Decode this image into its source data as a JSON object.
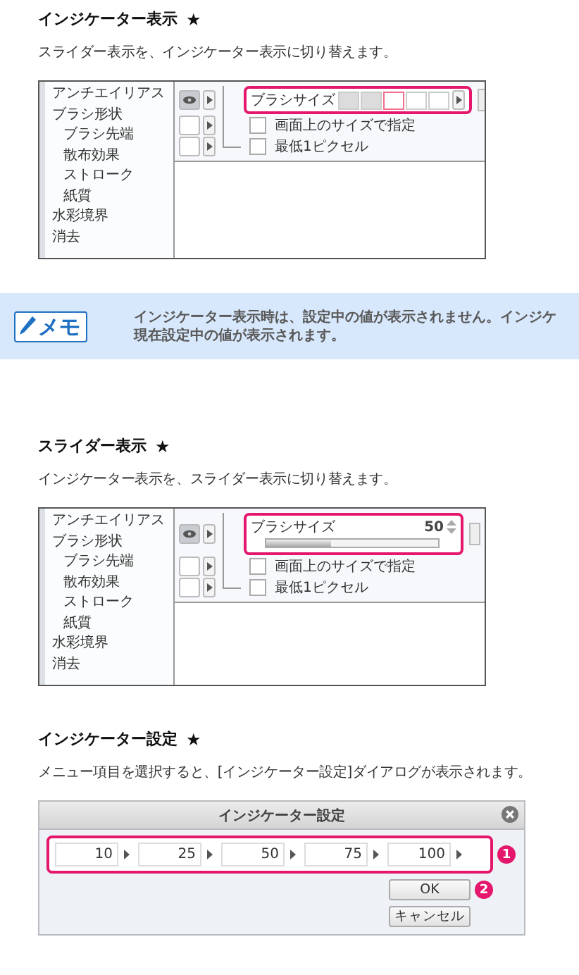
{
  "blocks": [
    {
      "kind": "section",
      "heading": "インジケーター表示",
      "mark": "★",
      "description": "スライダー表示を、インジケーター表示に切り替えます。",
      "panel": {
        "kind": "indicator",
        "categories": [
          {
            "label": "アンチエイリアス"
          },
          {
            "label": "ブラシ形状",
            "children": [
              {
                "label": "ブラシ先端"
              },
              {
                "label": "散布効果"
              },
              {
                "label": "ストローク"
              },
              {
                "label": "紙質"
              }
            ]
          },
          {
            "label": "水彩境界"
          },
          {
            "label": "消去"
          }
        ],
        "size_row": {
          "label": "ブラシサイズ",
          "eye": true,
          "cells": [
            {
              "filled": true,
              "selected": false
            },
            {
              "filled": true,
              "selected": false
            },
            {
              "filled": false,
              "selected": true
            },
            {
              "filled": false,
              "selected": false
            },
            {
              "filled": false,
              "selected": false
            }
          ]
        },
        "options": [
          {
            "label": "画面上のサイズで指定",
            "checked": false,
            "eye": false
          },
          {
            "label": "最低1ピクセル",
            "checked": false,
            "eye": false
          }
        ]
      }
    },
    {
      "kind": "memo",
      "label": "メモ",
      "lines": [
        "インジケーター表示時は、設定中の値が表示されません。インジケ",
        "現在設定中の値が表示されます。"
      ]
    },
    {
      "kind": "section",
      "heading": "スライダー表示",
      "mark": "★",
      "description": "インジケーター表示を、スライダー表示に切り替えます。",
      "panel": {
        "kind": "slider",
        "categories": [
          {
            "label": "アンチエイリアス"
          },
          {
            "label": "ブラシ形状",
            "children": [
              {
                "label": "ブラシ先端"
              },
              {
                "label": "散布効果"
              },
              {
                "label": "ストローク"
              },
              {
                "label": "紙質"
              }
            ]
          },
          {
            "label": "水彩境界"
          },
          {
            "label": "消去"
          }
        ],
        "size_row": {
          "label": "ブラシサイズ",
          "eye": true,
          "value": "50",
          "level": 0.38
        },
        "options": [
          {
            "label": "画面上のサイズで指定",
            "checked": false,
            "eye": false
          },
          {
            "label": "最低1ピクセル",
            "checked": false,
            "eye": false
          }
        ]
      }
    },
    {
      "kind": "section",
      "heading": "インジケーター設定",
      "mark": "★",
      "description": "メニュー項目を選択すると、[インジケーター設定]ダイアログが表示されます。",
      "dialog": {
        "title": "インジケーター設定",
        "fields": [
          "10",
          "25",
          "50",
          "75",
          "100"
        ],
        "fields_callout": "1",
        "buttons": [
          {
            "label": "OK",
            "callout": "2"
          },
          {
            "label": "キャンセル"
          }
        ]
      }
    }
  ]
}
